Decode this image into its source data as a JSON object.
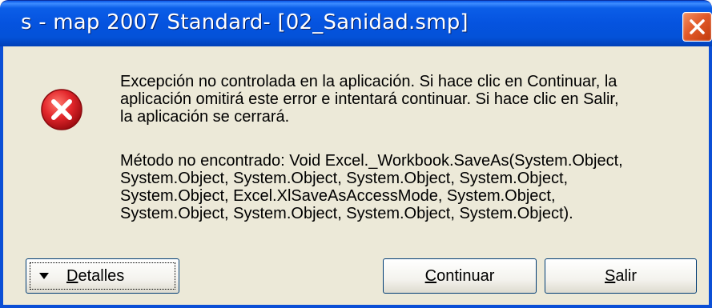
{
  "window": {
    "title": "s - map 2007 Standard- [02_Sanidad.smp]"
  },
  "icons": {
    "error": "error-x-icon",
    "close": "close-x-icon",
    "details_arrow": "triangle-down-icon"
  },
  "message": {
    "main": "Excepción no controlada en la aplicación. Si hace clic en Continuar, la\naplicación omitirá este error e intentará continuar. Si hace clic en Salir,\nla aplicación se cerrará.",
    "detail": "Método no encontrado: Void Excel._Workbook.SaveAs(System.Object,\nSystem.Object, System.Object, System.Object, System.Object,\nSystem.Object, Excel.XlSaveAsAccessMode, System.Object,\nSystem.Object, System.Object, System.Object, System.Object)."
  },
  "buttons": {
    "details_first": "D",
    "details_rest": "etalles",
    "continue_first": "C",
    "continue_rest": "ontinuar",
    "exit_first": "S",
    "exit_rest": "alir"
  },
  "colors": {
    "titlebar": "#0553df",
    "client_bg": "#ece9d8",
    "close_button": "#e25a2a",
    "error_icon": "#d4202b"
  }
}
